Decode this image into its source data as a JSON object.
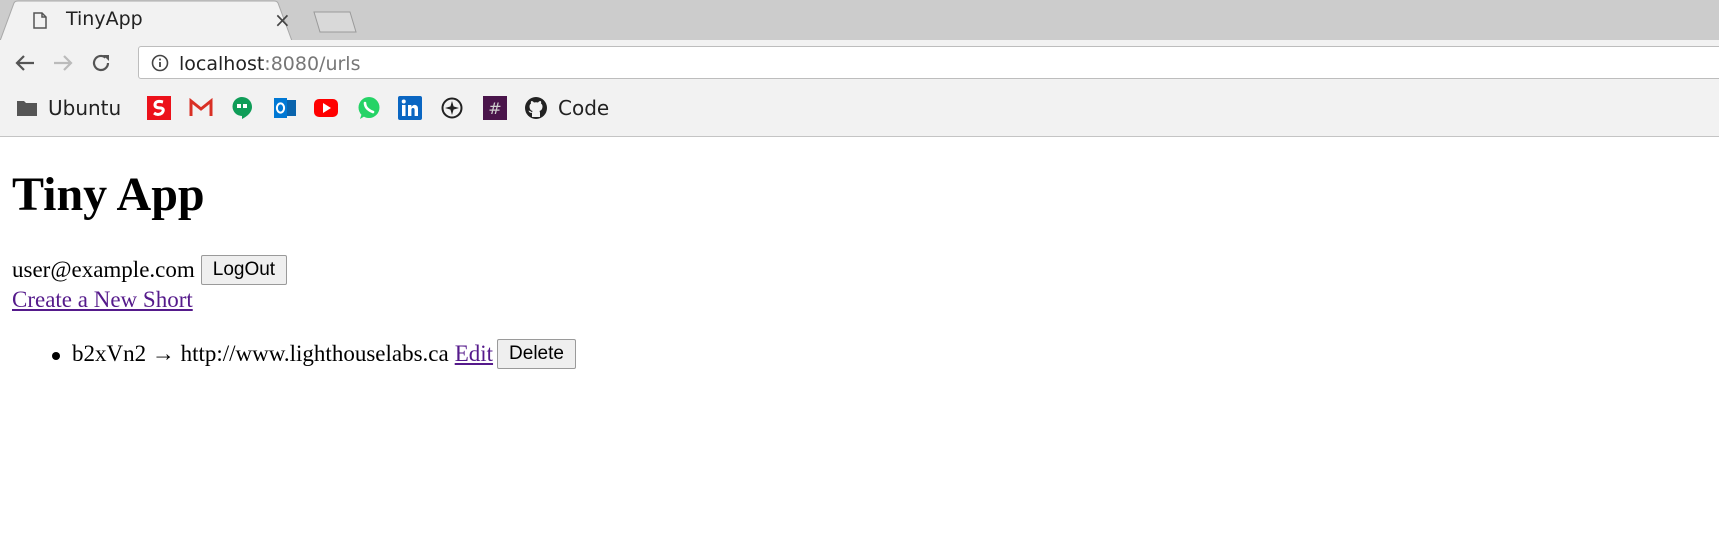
{
  "browser": {
    "tab": {
      "title": "TinyApp",
      "close_glyph": "×"
    },
    "address": {
      "host": "localhost",
      "rest": ":8080/urls"
    },
    "bookmarks": [
      {
        "icon": "folder-icon",
        "label": "Ubuntu"
      },
      {
        "icon": "scotiabank-icon",
        "label": ""
      },
      {
        "icon": "gmail-icon",
        "label": ""
      },
      {
        "icon": "hangouts-icon",
        "label": ""
      },
      {
        "icon": "outlook-icon",
        "label": ""
      },
      {
        "icon": "youtube-icon",
        "label": ""
      },
      {
        "icon": "whatsapp-icon",
        "label": ""
      },
      {
        "icon": "linkedin-icon",
        "label": ""
      },
      {
        "icon": "compass-icon",
        "label": ""
      },
      {
        "icon": "slack-icon",
        "label": ""
      },
      {
        "icon": "github-icon",
        "label": "Code"
      }
    ]
  },
  "page": {
    "title": "Tiny App",
    "user_email": "user@example.com",
    "logout_label": "LogOut",
    "create_link": "Create a New Short",
    "urls": [
      {
        "text": "b2xVn2 → http://www.lighthouselabs.ca",
        "edit_label": "Edit ",
        "delete_label": "Delete"
      }
    ]
  },
  "colors": {
    "link_visited": "#551a8b",
    "chrome_frame": "#cccccc",
    "toolbar": "#f2f2f2"
  }
}
